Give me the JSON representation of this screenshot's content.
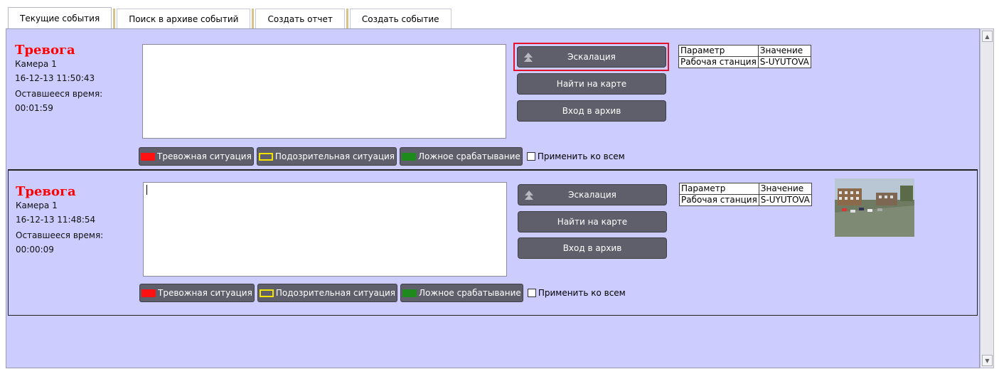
{
  "tabs": [
    "Текущие события",
    "Поиск в архиве событий",
    "Создать отчет",
    "Создать событие"
  ],
  "events": [
    {
      "title": "Тревога",
      "camera": "Камера 1",
      "datetime": "16-12-13 11:50:43",
      "remaining_label": "Оставшееся время:",
      "remaining": "00:01:59",
      "buttons": {
        "escalation": "Эскалация",
        "find_on_map": "Найти на карте",
        "archive": "Вход в архив"
      },
      "params": {
        "headers": [
          "Параметр",
          "Значение"
        ],
        "rows": [
          [
            "Рабочая станция",
            "S-UYUTOVA"
          ]
        ]
      },
      "marks": {
        "alarm": "Тревожная ситуация",
        "suspicious": "Подозрительная ситуация",
        "false": "Ложное срабатывание",
        "apply_all": "Применить ко всем"
      }
    },
    {
      "title": "Тревога",
      "camera": "Камера 1",
      "datetime": "16-12-13 11:48:54",
      "remaining_label": "Оставшееся время:",
      "remaining": "00:00:09",
      "buttons": {
        "escalation": "Эскалация",
        "find_on_map": "Найти на карте",
        "archive": "Вход в архив"
      },
      "params": {
        "headers": [
          "Параметр",
          "Значение"
        ],
        "rows": [
          [
            "Рабочая станция",
            "S-UYUTOVA"
          ]
        ]
      },
      "marks": {
        "alarm": "Тревожная ситуация",
        "suspicious": "Подозрительная ситуация",
        "false": "Ложное срабатывание",
        "apply_all": "Применить ко всем"
      }
    }
  ],
  "colors": {
    "panel": "#ccccff",
    "button": "#5f5f6b",
    "alarm_red": "#ff0000",
    "highlight": "#e4122a"
  },
  "icons": [
    "escalation-arrow-icon",
    "scroll-up-icon",
    "scroll-down-icon",
    "camera-thumbnail"
  ]
}
